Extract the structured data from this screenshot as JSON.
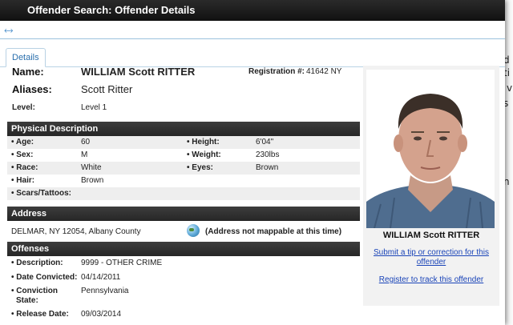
{
  "window": {
    "title": "Offender Search: Offender Details"
  },
  "toolbar": {
    "back_icon": "back-arrow-icon"
  },
  "tabs": [
    {
      "label": "Details"
    }
  ],
  "identity": {
    "name_label": "Name:",
    "name": "WILLIAM Scott RITTER",
    "registration_label": "Registration #:",
    "registration": "41642 NY",
    "aliases_label": "Aliases:",
    "aliases": "Scott Ritter",
    "level_label": "Level:",
    "level": "Level 1"
  },
  "physical": {
    "heading": "Physical Description",
    "rows": [
      {
        "l1": "• Age:",
        "v1": "60",
        "l2": "• Height:",
        "v2": "6'04\""
      },
      {
        "l1": "• Sex:",
        "v1": "M",
        "l2": "• Weight:",
        "v2": "230lbs"
      },
      {
        "l1": "• Race:",
        "v1": "White",
        "l2": "• Eyes:",
        "v2": "Brown"
      },
      {
        "l1": "• Hair:",
        "v1": "Brown",
        "l2": "",
        "v2": ""
      },
      {
        "l1": "• Scars/Tattoos:",
        "v1": "",
        "l2": "",
        "v2": ""
      }
    ]
  },
  "address": {
    "heading": "Address",
    "line": "DELMAR, NY 12054, Albany County",
    "map_icon": "globe-icon",
    "map_note": "(Address not mappable at this time)"
  },
  "offenses": {
    "heading": "Offenses",
    "description_label": "• Description:",
    "description": "9999 - OTHER CRIME",
    "convicted_label": "• Date Convicted:",
    "convicted": "04/14/2011",
    "state_label_1": "• Conviction",
    "state_label_2": "State:",
    "state": "Pennsylvania",
    "release_label": "• Release Date:",
    "release": "09/03/2014"
  },
  "photo": {
    "caption": "WILLIAM Scott RITTER",
    "tip_link_1": "Submit a tip or correction for this",
    "tip_link_2": "offender",
    "track_link": "Register to track this offender"
  },
  "background_page": {
    "chars": [
      "d",
      "ti",
      "v",
      "s",
      "n"
    ]
  }
}
